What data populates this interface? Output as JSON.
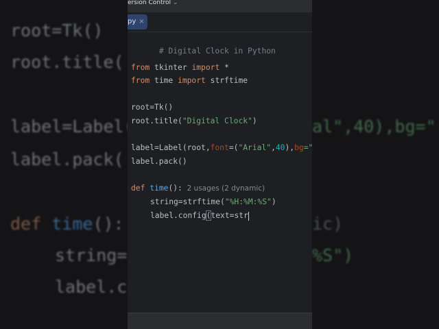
{
  "window": {
    "title_fragment": "ersion Control",
    "title_chevron": "⌄"
  },
  "tab": {
    "label": "py",
    "close": "×"
  },
  "editor": {
    "lines": [
      {
        "comment": "# Digital Clock in Python"
      },
      {
        "kw1": "from",
        "mid": " tkinter ",
        "kw2": "import",
        "rest": " *"
      },
      {
        "kw1": "from",
        "mid": " time ",
        "kw2": "import",
        "rest": " strftime"
      },
      {
        "text": "root=Tk()"
      },
      {
        "pre": "root.title(",
        "str": "\"Digital Clock\"",
        "post": ")"
      },
      {
        "pre": "label=Label(root,",
        "param1": "font",
        "eq": "=(",
        "str": "\"Arial\"",
        "comma": ",",
        "num": "40",
        "close": "),",
        "param2": "bg",
        "tail": "=\""
      },
      {
        "text": "label.pack()"
      },
      {
        "kw": "def",
        "sp": " ",
        "fn": "time",
        "post": "():",
        "hint": "  2 usages (2 dynamic)"
      },
      {
        "pre": "string=strftime(",
        "str": "\"%H:%M:%S\"",
        "post": ")"
      },
      {
        "pre": "label.config",
        "paren": "(",
        "post": "text=str"
      }
    ]
  },
  "background": {
    "l1": "root=Tk()",
    "l2": "root.title(",
    "l3a": "label=Label(",
    "l3b": "al\",40),bg=\"",
    "l4": "label.pack(",
    "l5kw": "def",
    "l5fn": "time",
    "l5rest": "():",
    "l5hint": "ic)",
    "l6a": "string=",
    "l6b": "%S\")",
    "l7": "label.c"
  }
}
